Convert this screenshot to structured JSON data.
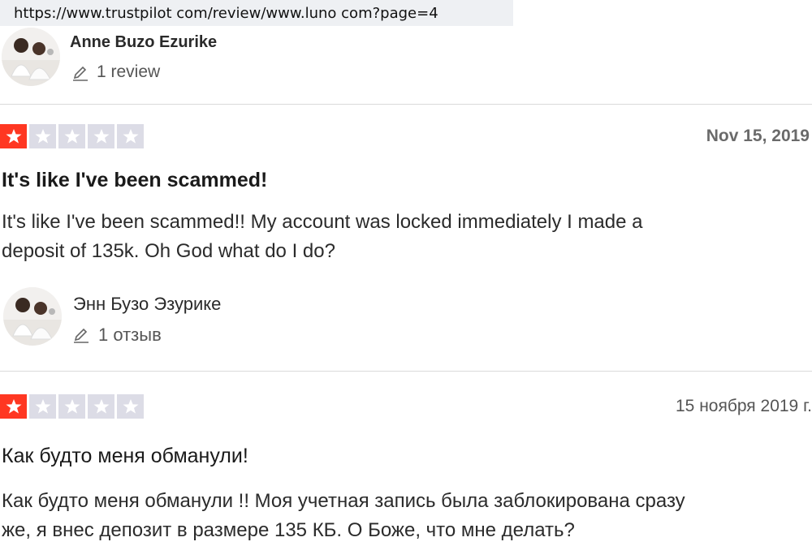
{
  "address_bar": {
    "url": "https://www.trustpilot com/review/www.luno com?page=4"
  },
  "reviews": [
    {
      "reviewer_name": "Anne Buzo Ezurike",
      "review_count": "1 review",
      "rating": 1,
      "rating_max": 5,
      "date": "Nov 15, 2019",
      "title": "It's like I've been scammed!",
      "body_line1": "It's like I've been scammed!! My account was locked immediately I made a",
      "body_line2": "deposit of 135k. Oh God what do I do?"
    },
    {
      "reviewer_name": "Энн Бузо Эзурике",
      "review_count": "1 отзыв",
      "rating": 1,
      "rating_max": 5,
      "date": "15 ноября 2019 г.",
      "title": "Как будто меня обманули!",
      "body_line1": "Как будто меня обманули !! Моя учетная запись была заблокирована сразу",
      "body_line2": "же, я внес депозит в размере 135 КБ. О Боже, что мне делать?"
    }
  ],
  "colors": {
    "star_filled": "#ff3722",
    "star_empty": "#dcdce6"
  }
}
